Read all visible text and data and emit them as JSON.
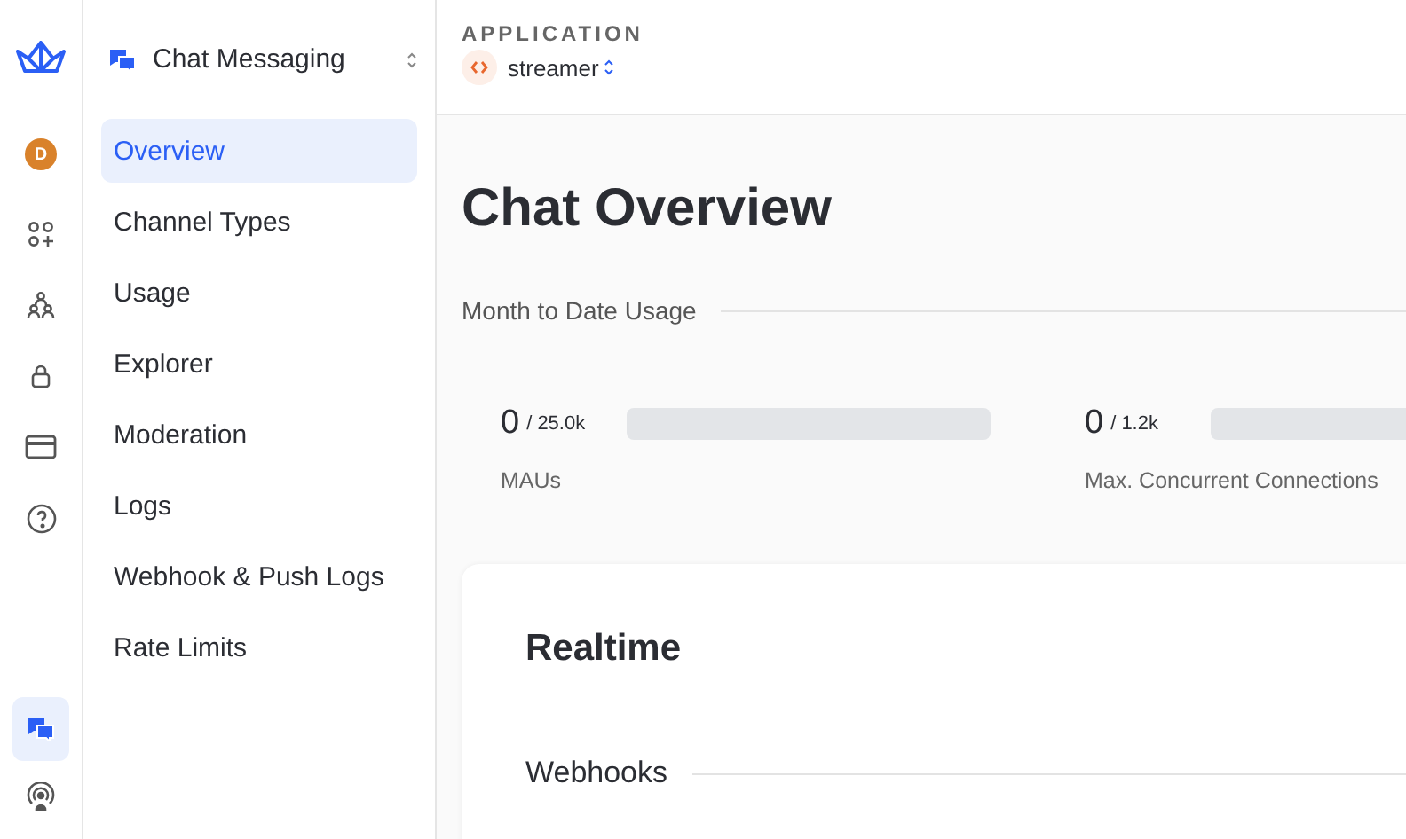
{
  "rail": {
    "avatar": "D",
    "items": [
      {
        "kind": "apps",
        "selected": false
      },
      {
        "kind": "team",
        "selected": false
      },
      {
        "kind": "lock",
        "selected": false
      },
      {
        "kind": "card",
        "selected": false
      },
      {
        "kind": "help",
        "selected": false
      }
    ],
    "bottom_items": [
      {
        "kind": "chat",
        "selected": true
      },
      {
        "kind": "broadcast",
        "selected": false
      }
    ]
  },
  "sidebar": {
    "product": "Chat Messaging",
    "items": [
      {
        "label": "Overview",
        "selected": true
      },
      {
        "label": "Channel Types",
        "selected": false
      },
      {
        "label": "Usage",
        "selected": false
      },
      {
        "label": "Explorer",
        "selected": false
      },
      {
        "label": "Moderation",
        "selected": false
      },
      {
        "label": "Logs",
        "selected": false
      },
      {
        "label": "Webhook & Push Logs",
        "selected": false
      },
      {
        "label": "Rate Limits",
        "selected": false
      }
    ]
  },
  "header": {
    "label": "APPLICATION",
    "app": "streamer"
  },
  "title": "Chat Overview",
  "usage": {
    "heading": "Month to Date Usage",
    "meters": [
      {
        "value": "0",
        "limit": "/ 25.0k",
        "label": "MAUs",
        "level": 0
      },
      {
        "value": "0",
        "limit": "/ 1.2k",
        "label": "Max. Concurrent Connections",
        "level": 0
      }
    ]
  },
  "card": {
    "title": "Realtime",
    "section": "Webhooks"
  }
}
